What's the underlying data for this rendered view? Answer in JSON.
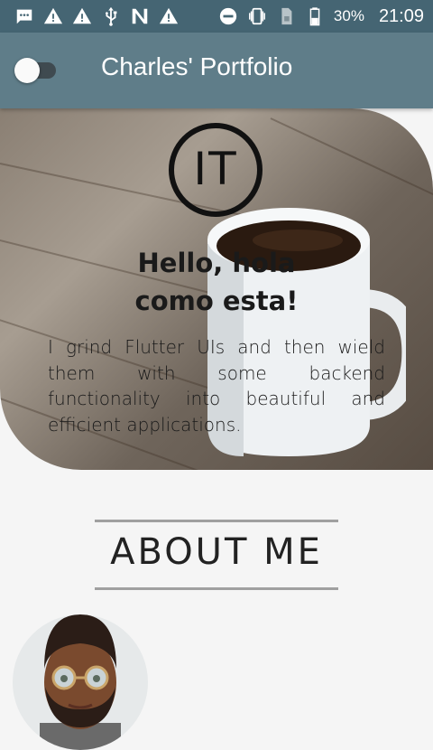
{
  "status_bar": {
    "battery_percent": "30%",
    "time": "21:09",
    "left_icons": [
      "message-icon",
      "warning-icon",
      "warning-icon",
      "usb-icon",
      "nfc-icon",
      "warning-icon"
    ],
    "right_icons": [
      "do-not-disturb-icon",
      "vibrate-icon",
      "sim-icon",
      "battery-icon"
    ]
  },
  "app_bar": {
    "title": "Charles' Portfolio",
    "toggle_on": false
  },
  "hero": {
    "logo_text": "IT",
    "title_line1": "Hello, hola",
    "title_line2": "como esta!",
    "description": "I grind Flutter UIs and then wield them with some backend functionality into beautiful and efficient applications."
  },
  "about": {
    "title": "ABOUT ME"
  },
  "colors": {
    "status_bar": "#456573",
    "app_bar": "#5f7d89",
    "background": "#f5f5f5"
  }
}
